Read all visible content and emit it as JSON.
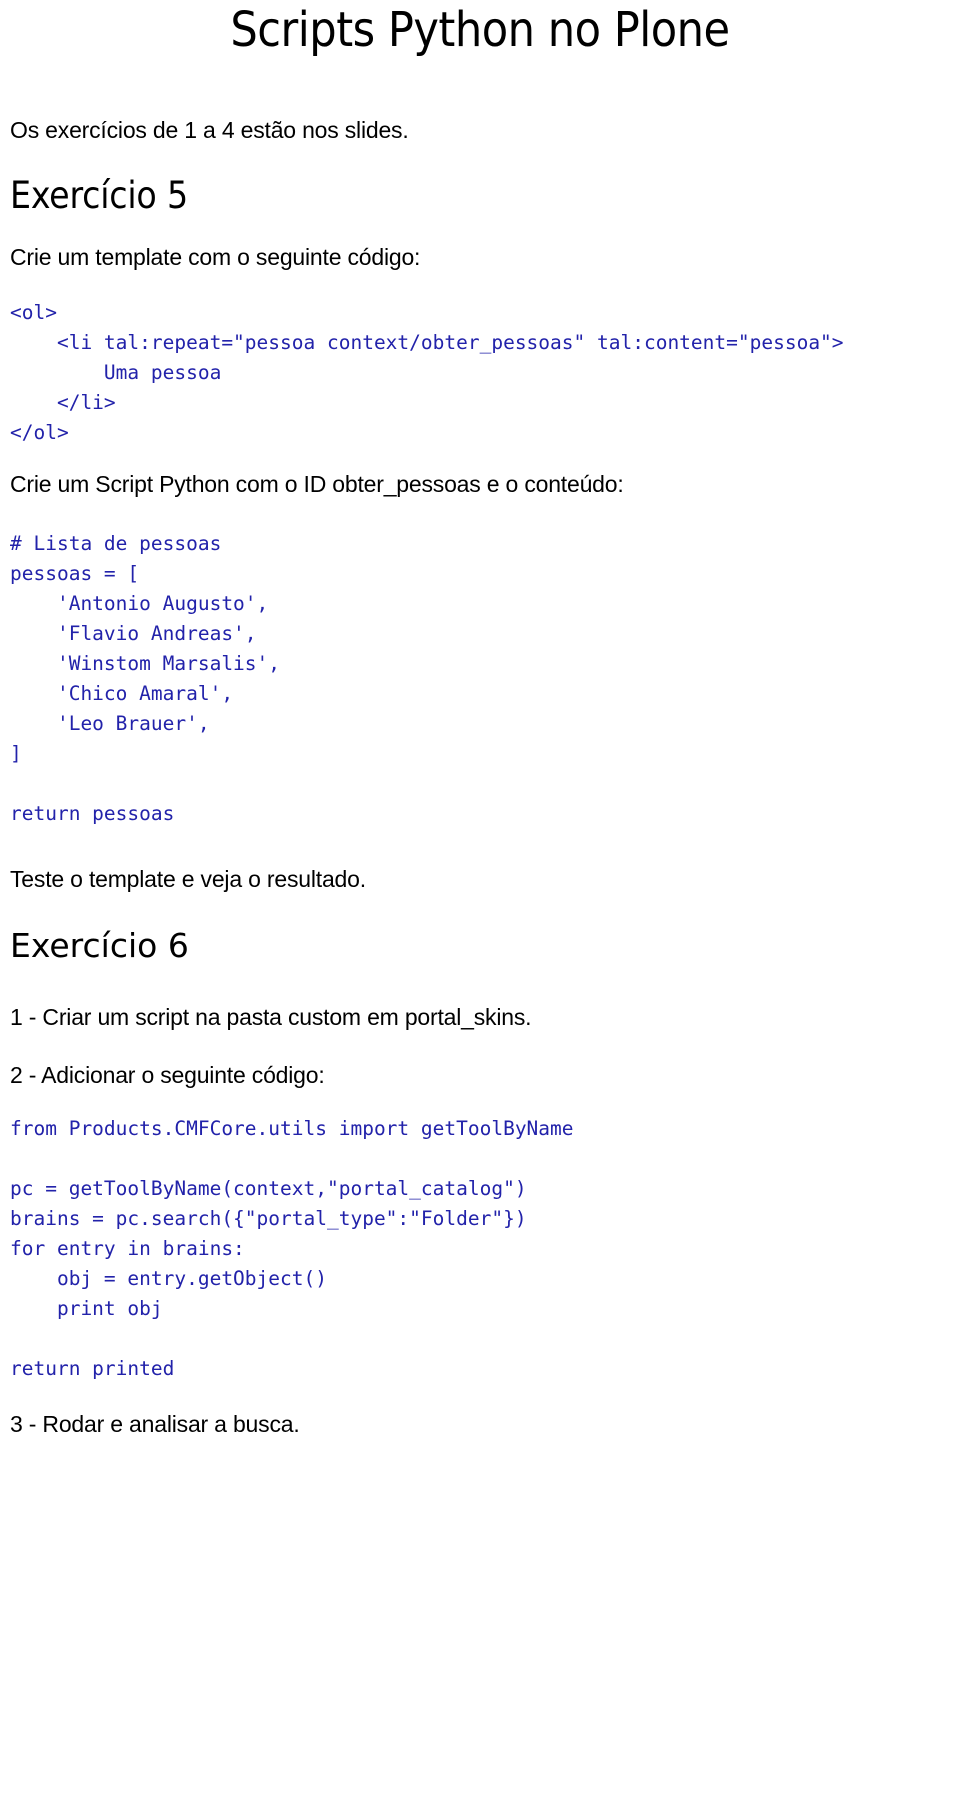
{
  "document": {
    "title": "Scripts Python no Plone",
    "intro": "Os exercícios de 1 a 4 estão nos slides.",
    "code_color": "#2222AA",
    "text_color": "#000000",
    "background_color": "#FFFFFF"
  },
  "exercise5": {
    "heading": "Exercício 5",
    "instruction_template": "Crie um template com o seguinte código:",
    "template_code": "<ol>\n    <li tal:repeat=\"pessoa context/obter_pessoas\" tal:content=\"pessoa\">\n        Uma pessoa\n    </li>\n</ol>",
    "instruction_script": "Crie um Script Python com o ID obter_pessoas e o conteúdo:",
    "script_code": "# Lista de pessoas\npessoas = [\n    'Antonio Augusto',\n    'Flavio Andreas',\n    'Winstom Marsalis',\n    'Chico Amaral',\n    'Leo Brauer',\n]\n\nreturn pessoas",
    "pessoas_list": [
      "Antonio Augusto",
      "Flavio Andreas",
      "Winstom Marsalis",
      "Chico Amaral",
      "Leo Brauer"
    ],
    "closing": "Teste o template e veja o resultado."
  },
  "exercise6": {
    "heading": "Exercício 6",
    "step1": "1 - Criar um script na pasta custom em portal_skins.",
    "step2": "2 - Adicionar o seguinte código:",
    "code": "from Products.CMFCore.utils import getToolByName\n\npc = getToolByName(context,\"portal_catalog\")\nbrains = pc.search({\"portal_type\":\"Folder\"})\nfor entry in brains:\n    obj = entry.getObject()\n    print obj\n\nreturn printed",
    "step3": "3 - Rodar e analisar a busca."
  }
}
